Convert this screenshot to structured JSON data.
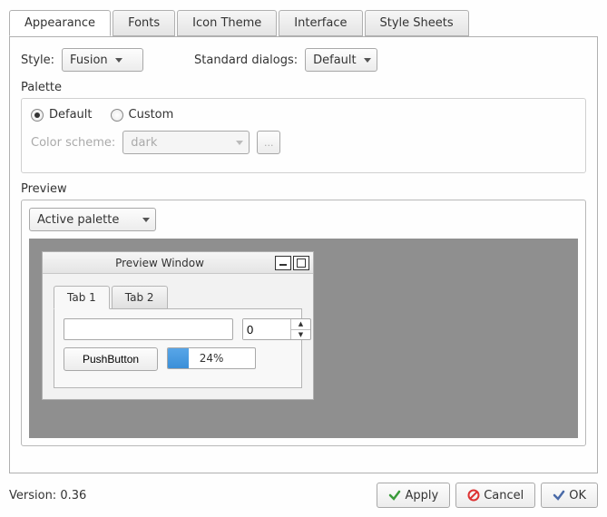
{
  "tabs": {
    "items": [
      "Appearance",
      "Fonts",
      "Icon Theme",
      "Interface",
      "Style Sheets"
    ]
  },
  "style": {
    "label": "Style:",
    "value": "Fusion"
  },
  "std_dialogs": {
    "label": "Standard dialogs:",
    "value": "Default"
  },
  "palette": {
    "title": "Palette",
    "default": "Default",
    "custom": "Custom",
    "color_scheme_label": "Color scheme:",
    "color_scheme_value": "dark",
    "browse_btn": "..."
  },
  "preview": {
    "title": "Preview",
    "dropdown": "Active palette",
    "window_title": "Preview Window",
    "tabs": [
      "Tab 1",
      "Tab 2"
    ],
    "spin_value": "0",
    "push_label": "PushButton",
    "progress_text": "24%"
  },
  "footer": {
    "version": "Version: 0.36",
    "apply": "Apply",
    "cancel": "Cancel",
    "ok": "OK"
  }
}
